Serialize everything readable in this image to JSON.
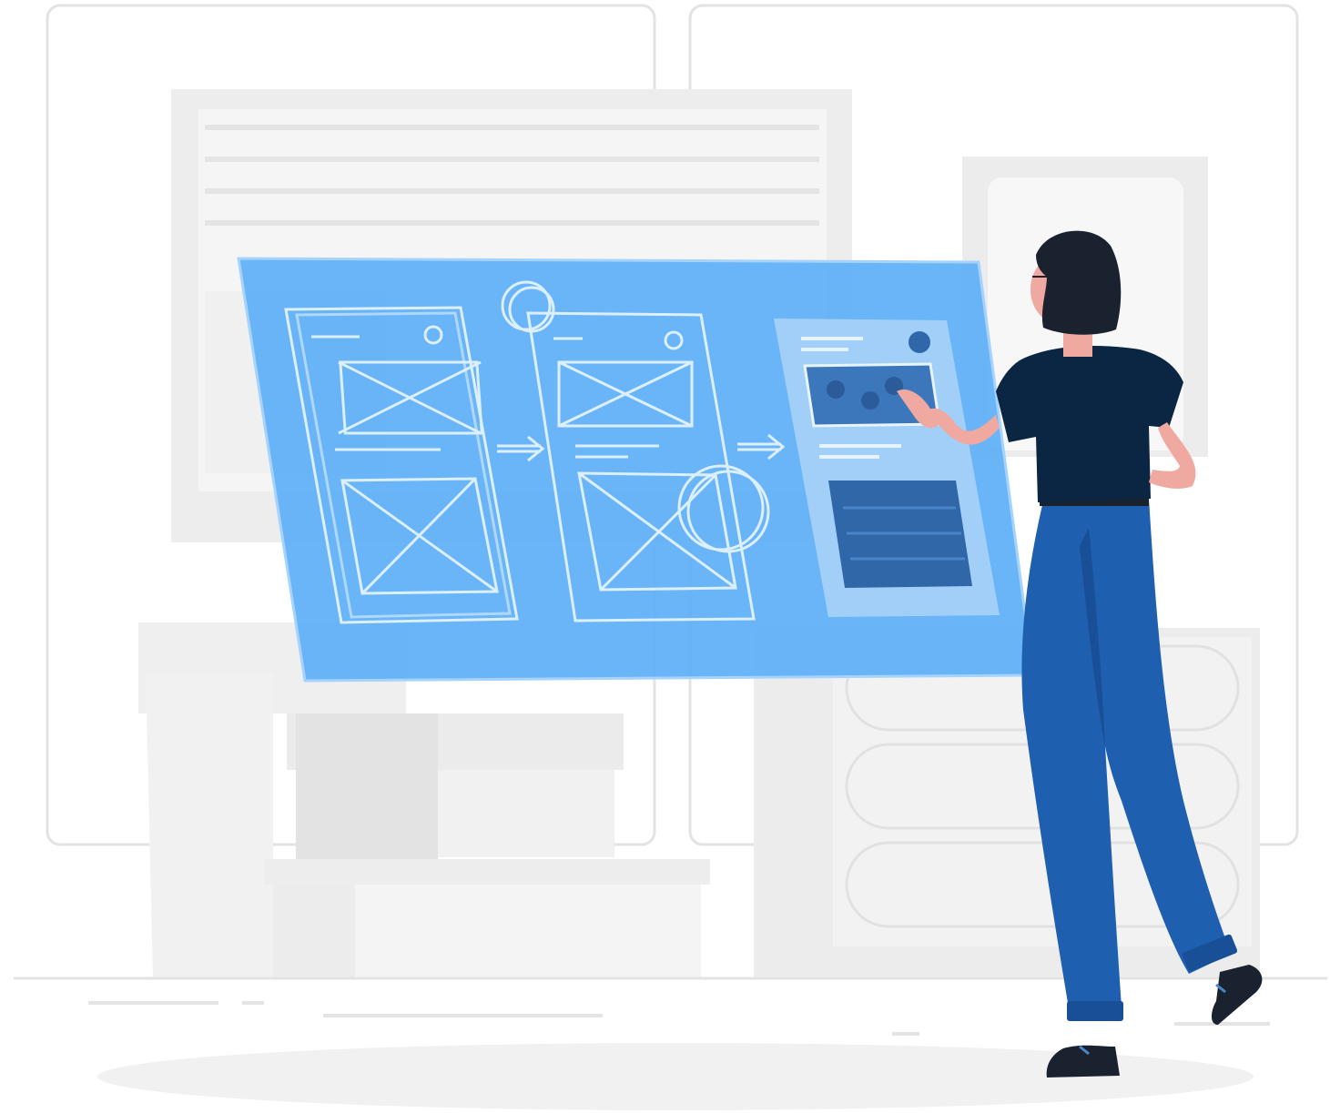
{
  "illustration": {
    "subject": "",
    "colors": {
      "background": "#ffffff",
      "panel_outline": "#e3e3e3",
      "furniture_light": "#f4f4f4",
      "furniture_mid": "#ebebeb",
      "furniture_dark": "#e0e0e0",
      "screen_blue": "#5faff6",
      "screen_line": "#d8ecff",
      "card_light": "#a9d2f7",
      "card_dark": "#2f67a8",
      "person_shirt": "#0b2642",
      "person_hair": "#1a2230",
      "person_pants": "#1f5fb0",
      "person_pants_shadow": "#184f96",
      "skin": "#f0a9a0",
      "floor_shadow": "#f1f1f1"
    },
    "icons": [
      "wireframe-sketch",
      "arrow-right",
      "circle-sketch",
      "ui-card",
      "person"
    ]
  }
}
